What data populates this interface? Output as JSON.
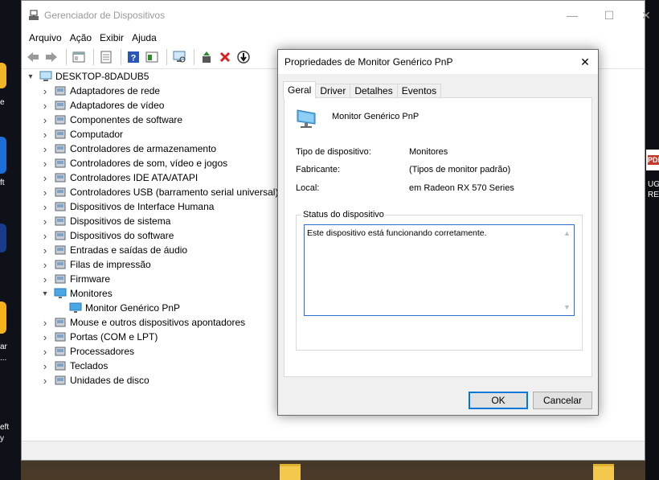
{
  "window": {
    "title": "Gerenciador de Dispositivos",
    "controls": {
      "minimize": "—",
      "maximize": "☐",
      "close": "✕"
    }
  },
  "menu": [
    "Arquivo",
    "Ação",
    "Exibir",
    "Ajuda"
  ],
  "toolbar": {
    "icons": [
      "back-arrow-icon",
      "forward-arrow-icon",
      "show-hide-icon",
      "properties-icon",
      "help-icon",
      "action-view-icon",
      "scan-hardware-icon",
      "update-driver-icon",
      "uninstall-icon",
      "disable-icon"
    ],
    "colors": {
      "uninstall": "#d61f1f",
      "help": "#2a55b8",
      "update": "#2e8b2e"
    }
  },
  "tree": {
    "root": "DESKTOP-8DADUB5",
    "items": [
      {
        "label": "Adaptadores de rede",
        "icon": "network-adapter-icon",
        "expanded": false
      },
      {
        "label": "Adaptadores de vídeo",
        "icon": "display-adapter-icon",
        "expanded": false
      },
      {
        "label": "Componentes de software",
        "icon": "software-component-icon",
        "expanded": false
      },
      {
        "label": "Computador",
        "icon": "computer-icon",
        "expanded": false
      },
      {
        "label": "Controladores de armazenamento",
        "icon": "storage-controller-icon",
        "expanded": false
      },
      {
        "label": "Controladores de som, vídeo e jogos",
        "icon": "sound-icon",
        "expanded": false
      },
      {
        "label": "Controladores IDE ATA/ATAPI",
        "icon": "ide-controller-icon",
        "expanded": false
      },
      {
        "label": "Controladores USB (barramento serial universal)",
        "icon": "usb-icon",
        "expanded": false
      },
      {
        "label": "Dispositivos de Interface Humana",
        "icon": "hid-icon",
        "expanded": false
      },
      {
        "label": "Dispositivos de sistema",
        "icon": "system-device-icon",
        "expanded": false
      },
      {
        "label": "Dispositivos do software",
        "icon": "software-device-icon",
        "expanded": false
      },
      {
        "label": "Entradas e saídas de áudio",
        "icon": "audio-io-icon",
        "expanded": false
      },
      {
        "label": "Filas de impressão",
        "icon": "printer-icon",
        "expanded": false
      },
      {
        "label": "Firmware",
        "icon": "firmware-icon",
        "expanded": false
      },
      {
        "label": "Monitores",
        "icon": "monitor-icon",
        "expanded": true
      },
      {
        "label": "Mouse e outros dispositivos apontadores",
        "icon": "mouse-icon",
        "expanded": false
      },
      {
        "label": "Portas (COM e LPT)",
        "icon": "port-icon",
        "expanded": false
      },
      {
        "label": "Processadores",
        "icon": "processor-icon",
        "expanded": false
      },
      {
        "label": "Teclados",
        "icon": "keyboard-icon",
        "expanded": false
      },
      {
        "label": "Unidades de disco",
        "icon": "disk-drive-icon",
        "expanded": false
      }
    ],
    "child_of_monitores": "Monitor Genérico PnP"
  },
  "dialog": {
    "title": "Propriedades de Monitor Genérico PnP",
    "close": "✕",
    "tabs": [
      "Geral",
      "Driver",
      "Detalhes",
      "Eventos"
    ],
    "active_tab": "Geral",
    "device_name": "Monitor Genérico PnP",
    "properties": [
      {
        "label": "Tipo de dispositivo:",
        "value": "Monitores"
      },
      {
        "label": "Fabricante:",
        "value": "(Tipos de monitor padrão)"
      },
      {
        "label": "Local:",
        "value": "em Radeon RX 570 Series"
      }
    ],
    "status_group_title": "Status do dispositivo",
    "status_text": "Este dispositivo está funcionando corretamente.",
    "ok_label": "OK",
    "cancel_label": "Cancelar"
  },
  "desktop": {
    "left_labels": [
      "e",
      "ft",
      "ar",
      "...",
      "eft",
      "y"
    ],
    "right_labels": [
      "PDF",
      "UG",
      "REC"
    ]
  }
}
